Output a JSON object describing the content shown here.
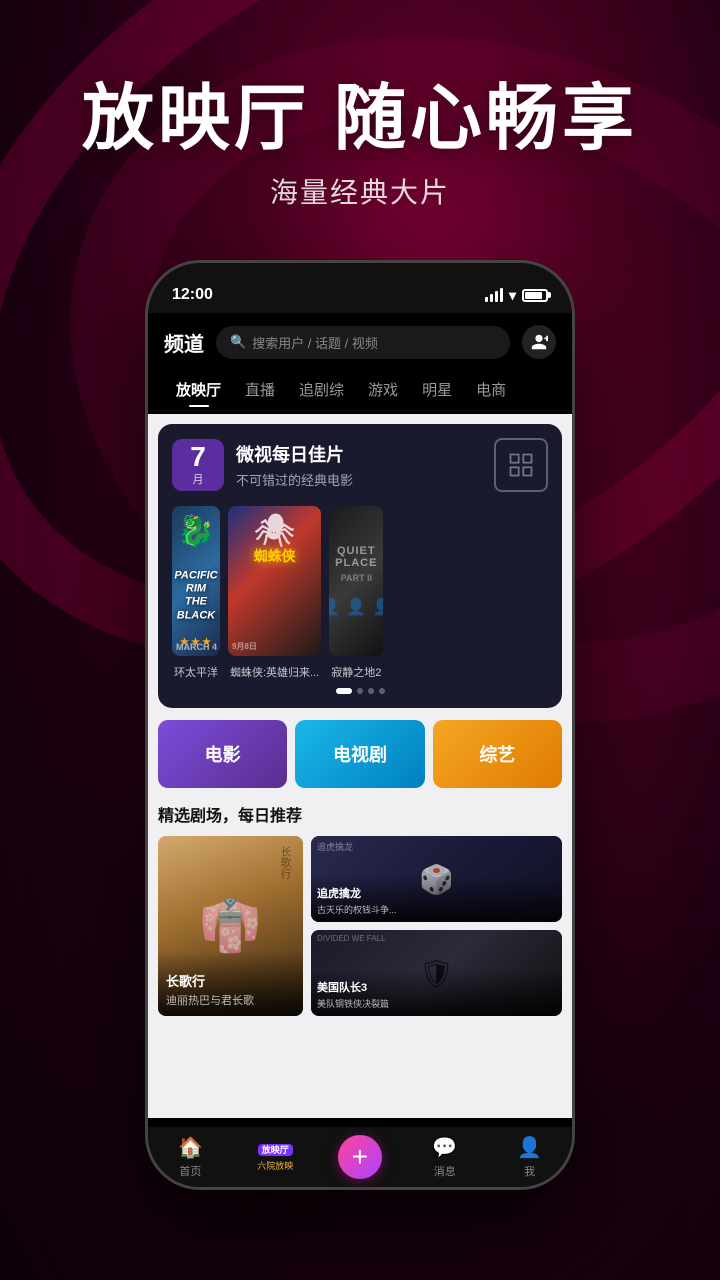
{
  "hero": {
    "title": "放映厅 随心畅享",
    "subtitle": "海量经典大片"
  },
  "phone": {
    "status_bar": {
      "time": "12:00"
    },
    "header": {
      "logo": "频道",
      "search_placeholder": "搜索用户 / 话题 / 视频"
    },
    "nav_tabs": [
      {
        "label": "放映厅",
        "active": true
      },
      {
        "label": "直播",
        "active": false
      },
      {
        "label": "追剧综",
        "active": false
      },
      {
        "label": "游戏",
        "active": false
      },
      {
        "label": "明星",
        "active": false
      },
      {
        "label": "电商",
        "active": false
      }
    ],
    "banner": {
      "month_num": "7",
      "month_label": "月",
      "title": "微视每日佳片",
      "subtitle": "不可错过的经典电影",
      "movies": [
        {
          "title": "环太平洋",
          "text_overlay": "PACIFIC RIM\nTHE BLACK"
        },
        {
          "title": "蜘蛛侠:英雄归来...",
          "text_overlay": "蜘蛛侠"
        },
        {
          "title": "寂静之地2",
          "text_overlay": ""
        }
      ],
      "dots": [
        true,
        false,
        false,
        false
      ]
    },
    "categories": [
      {
        "label": "电影",
        "color": "purple"
      },
      {
        "label": "电视剧",
        "color": "blue"
      },
      {
        "label": "综艺",
        "color": "orange"
      }
    ],
    "rec_section": {
      "title": "精选剧场，每日推荐",
      "items": [
        {
          "name": "长歌行",
          "desc": "迪丽热巴与君长歌"
        },
        {
          "name": "追虎擒龙",
          "desc": "古天乐的权钱斗争..."
        },
        {
          "name": "美国队长3",
          "desc": "美队钢铁侠决裂篇"
        }
      ]
    },
    "bottom_nav": [
      {
        "label": "首页",
        "icon": "🏠",
        "active": false
      },
      {
        "label": "放映厅",
        "icon": "📺",
        "active": true
      },
      {
        "label": "+",
        "icon": "+",
        "active": false,
        "is_plus": true
      },
      {
        "label": "消息",
        "icon": "💬",
        "active": false
      },
      {
        "label": "我",
        "icon": "👤",
        "active": false
      }
    ]
  }
}
